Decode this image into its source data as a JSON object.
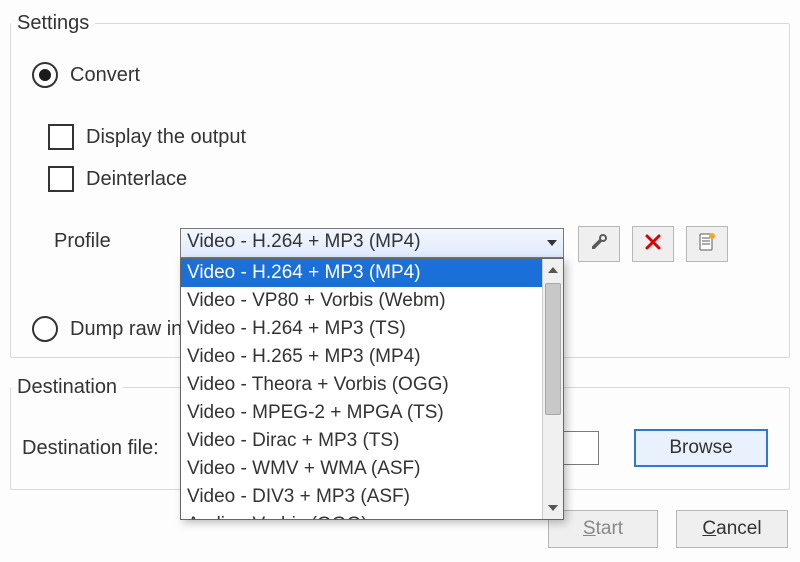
{
  "settings": {
    "legend": "Settings",
    "convert_label": "Convert",
    "display_output_label": "Display the output",
    "deinterlace_label": "Deinterlace",
    "profile_label": "Profile",
    "profile_selected": "Video - H.264 + MP3 (MP4)",
    "profile_options": [
      "Video - H.264 + MP3 (MP4)",
      "Video - VP80 + Vorbis (Webm)",
      "Video - H.264 + MP3 (TS)",
      "Video - H.265 + MP3 (MP4)",
      "Video - Theora + Vorbis (OGG)",
      "Video - MPEG-2 + MPGA (TS)",
      "Video - Dirac + MP3 (TS)",
      "Video - WMV + WMA (ASF)",
      "Video - DIV3 + MP3 (ASF)",
      "Audio - Vorbis (OGG)"
    ],
    "dump_raw_label": "Dump raw in"
  },
  "destination": {
    "legend": "Destination",
    "file_label": "Destination file:",
    "file_value": "",
    "browse_label": "Browse"
  },
  "footer": {
    "start_label": "Start",
    "cancel_label": "Cancel"
  },
  "icons": {
    "wrench": "wrench-icon",
    "delete": "delete-icon",
    "newdoc": "new-document-icon"
  }
}
